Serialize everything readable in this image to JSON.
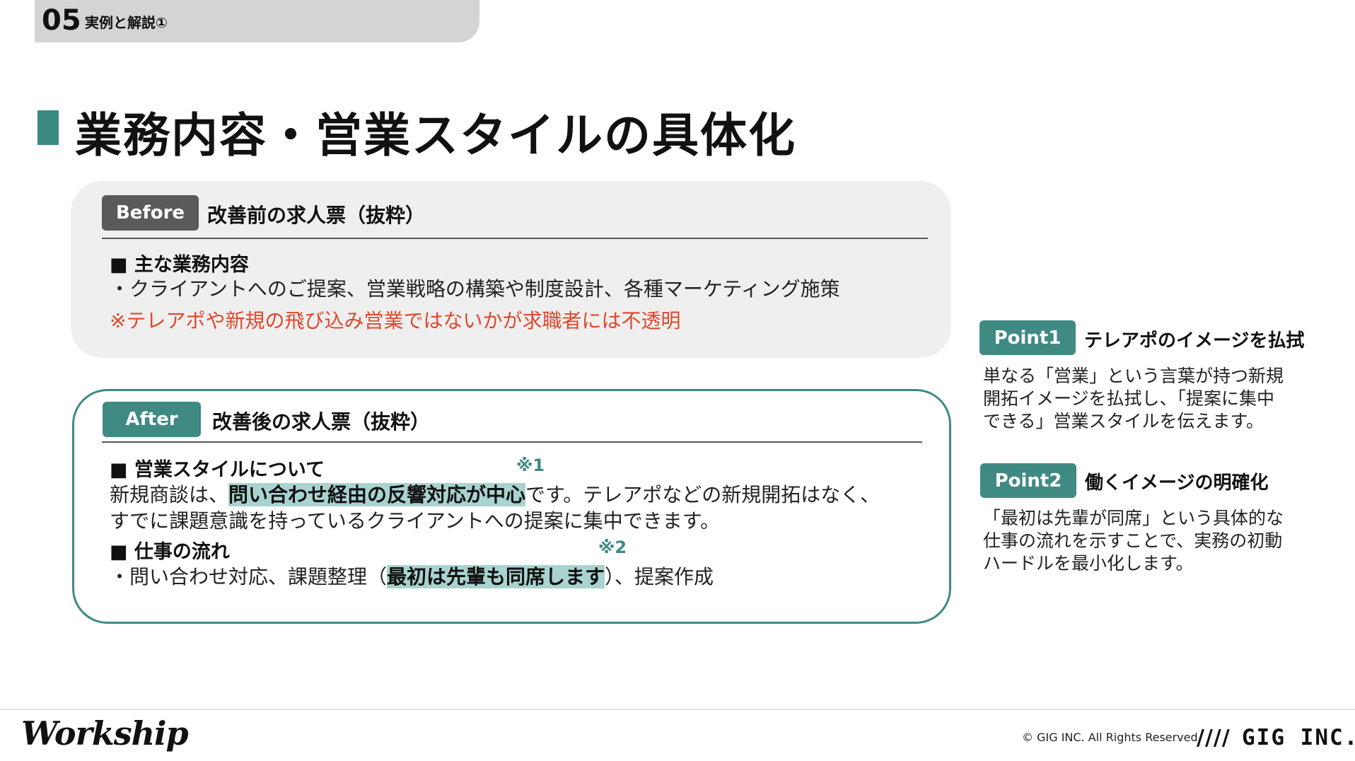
{
  "header": {
    "section_number": "05",
    "section_label": "実例と解説①",
    "page_title": "業務内容・営業スタイルの具体化"
  },
  "before": {
    "badge": "Before",
    "heading": "改善前の求人票（抜粋）",
    "section_head": "■ 主な業務内容",
    "line1": "・クライアントへのご提案、営業戦略の構築や制度設計、各種マーケティング施策",
    "note": "※テレアポや新規の飛び込み営業ではないかが求職者には不透明"
  },
  "after": {
    "badge": "After",
    "heading": "改善後の求人票（抜粋）",
    "section1_head": "■ 営業スタイルについて",
    "note_mark1": "※1",
    "line1_pre": "新規商談は、",
    "line1_highlight": "問い合わせ経由の反響対応が中心",
    "line1_post": "です。テレアポなどの新規開拓はなく、",
    "line2": "すでに課題意識を持っているクライアントへの提案に集中できます。",
    "section2_head": "■ 仕事の流れ",
    "note_mark2": "※2",
    "line3_pre": "・問い合わせ対応、課題整理（",
    "line3_highlight": "最初は先輩も同席します",
    "line3_post": "）、提案作成"
  },
  "points": [
    {
      "badge": "Point1",
      "title": "テレアポのイメージを払拭",
      "desc": [
        "単なる「営業」という言葉が持つ新規",
        "開拓イメージを払拭し、「提案に集中",
        "できる」営業スタイルを伝えます。"
      ]
    },
    {
      "badge": "Point2",
      "title": "働くイメージの明確化",
      "desc": [
        "「最初は先輩が同席」という具体的な",
        "仕事の流れを示すことで、実務の初動",
        "ハードルを最小化します。"
      ]
    }
  ],
  "footer": {
    "brand": "Workship",
    "copyright": "© GIG INC. All Rights Reserved.",
    "company_mark": "////",
    "company": "GIG INC."
  },
  "colors": {
    "accent": "#3f8a83",
    "highlight": "#a9d3ce",
    "warning": "#e0472a",
    "panel_bg": "#efefef",
    "before_badge": "#5a5a5a"
  }
}
